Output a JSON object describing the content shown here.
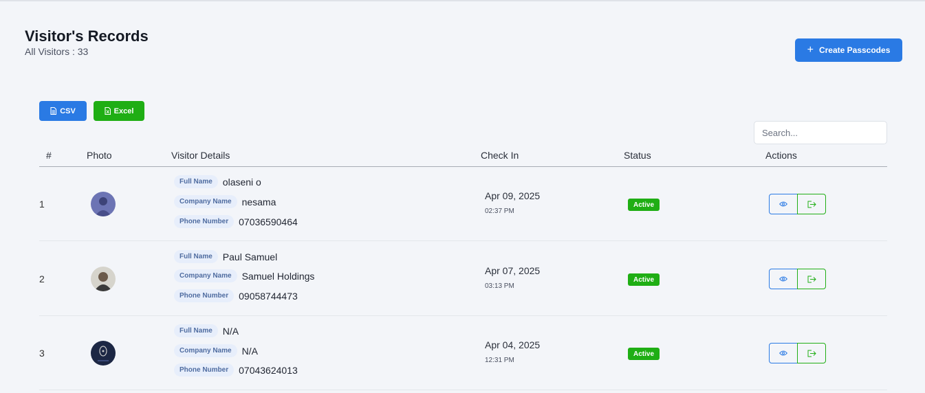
{
  "header": {
    "title": "Visitor's Records",
    "subtitle": "All Visitors : 33",
    "create_label": "Create Passcodes"
  },
  "toolbar": {
    "csv_label": "CSV",
    "excel_label": "Excel",
    "search_placeholder": "Search..."
  },
  "table": {
    "columns": [
      "#",
      "Photo",
      "Visitor Details",
      "Check In",
      "Status",
      "Actions"
    ],
    "field_labels": {
      "full_name": "Full Name",
      "company": "Company Name",
      "phone": "Phone Number"
    },
    "rows": [
      {
        "index": "1",
        "full_name": "olaseni o",
        "company": "nesama",
        "phone": "07036590464",
        "date": "Apr 09, 2025",
        "time": "02:37 PM",
        "status": "Active"
      },
      {
        "index": "2",
        "full_name": "Paul Samuel",
        "company": "Samuel Holdings",
        "phone": "09058744473",
        "date": "Apr 07, 2025",
        "time": "03:13 PM",
        "status": "Active"
      },
      {
        "index": "3",
        "full_name": "N/A",
        "company": "N/A",
        "phone": "07043624013",
        "date": "Apr 04, 2025",
        "time": "12:31 PM",
        "status": "Active"
      }
    ]
  },
  "colors": {
    "primary": "#2a7ae4",
    "success": "#1fae14",
    "background": "#f3f5f9"
  }
}
